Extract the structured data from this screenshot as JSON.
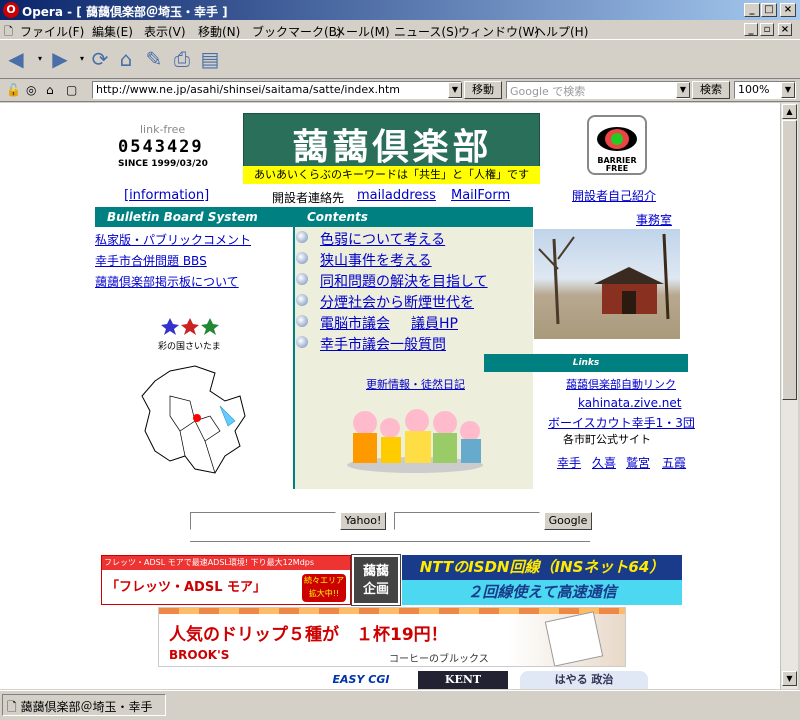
{
  "window": {
    "title": "Opera - [ 藹藹倶楽部＠埼玉・幸手 ]",
    "app_icon": "opera-o-icon",
    "controls": [
      "minimize-icon",
      "maximize-icon",
      "close-icon"
    ]
  },
  "menu": [
    "ファイル(F)",
    "編集(E)",
    "表示(V)",
    "移動(N)",
    "ブックマーク(B)",
    "メール(M)",
    "ニュース(S)",
    "ウィンドウ(W)",
    "ヘルプ(H)"
  ],
  "address_bar": {
    "url": "http://www.ne.jp/asahi/shinsei/saitama/satte/index.htm",
    "go_label": "移動",
    "search_placeholder": "Google で検索",
    "search_label": "検索",
    "zoom": "100%"
  },
  "page": {
    "counter_label": "link-free",
    "counter_value": "0543429",
    "counter_since": "SINCE 1999/03/20",
    "logo_title": "藹藹倶楽部",
    "logo_subtitle": "あいあいくらぶのキーワードは「共生」と「人権」です",
    "barrier_free": "BARRIER FREE",
    "information": "[information]",
    "contact_label": "開設者連絡先",
    "mailaddress": "mailaddress",
    "mailform": "MailForm",
    "self_intro": "開設者自己紹介",
    "office": "事務室",
    "bbs_header": "Bulletin Board System",
    "contents_header": "Contents",
    "bbs_links": [
      "私家版・パブリックコメント",
      "幸手市合併問題 BBS",
      "藹藹倶楽部掲示板について"
    ],
    "contents_links": [
      "色弱について考える",
      "狭山事件を考える",
      "同和問題の解決を目指して",
      "分煙社会から断煙世代を",
      "電脳市議会",
      "議員HP",
      "幸手市議会一般質問"
    ],
    "saitama_label": "彩の国さいたま",
    "links_header": "Links",
    "update_info": "更新情報・徒然日記",
    "right_links": [
      "藹藹倶楽部自動リンク",
      "kahinata.zive.net",
      "ボーイスカウト幸手1・3団"
    ],
    "city_sites_label": "各市町公式サイト",
    "city_links": [
      "幸手",
      "久喜",
      "鷲宮",
      "五霞"
    ],
    "yahoo_button": "Yahoo!",
    "google_button": "Google",
    "ad1_left_top": "フレッツ・ADSL モアで最速ADSL環境! 下り最大12Mdps",
    "ad1_left_main": "「フレッツ・ADSL モア」",
    "ad1_badge": "続々エリア拡大中!!",
    "ad1_center": "藹藹企画",
    "ad1_right_top": "NTTのISDN回線（INSネット64）",
    "ad1_right_bottom": "２回線使えて高速通信",
    "ad2_main": "人気のドリップ５種が　１杯19円！",
    "ad2_brand": "BROOK'S",
    "ad2_sub": "コーヒーのブルックス",
    "ad3": [
      "EASY CGI",
      "KENT",
      "はやる 政治"
    ]
  },
  "statusbar": {
    "text": "藹藹倶楽部＠埼玉・幸手"
  },
  "colors": {
    "teal": "#008080",
    "title_gradient_start": "#0a246a",
    "title_gradient_end": "#a6caf0",
    "logo_bg": "#2a6f5a",
    "subtitle_bg": "#ffff00"
  }
}
